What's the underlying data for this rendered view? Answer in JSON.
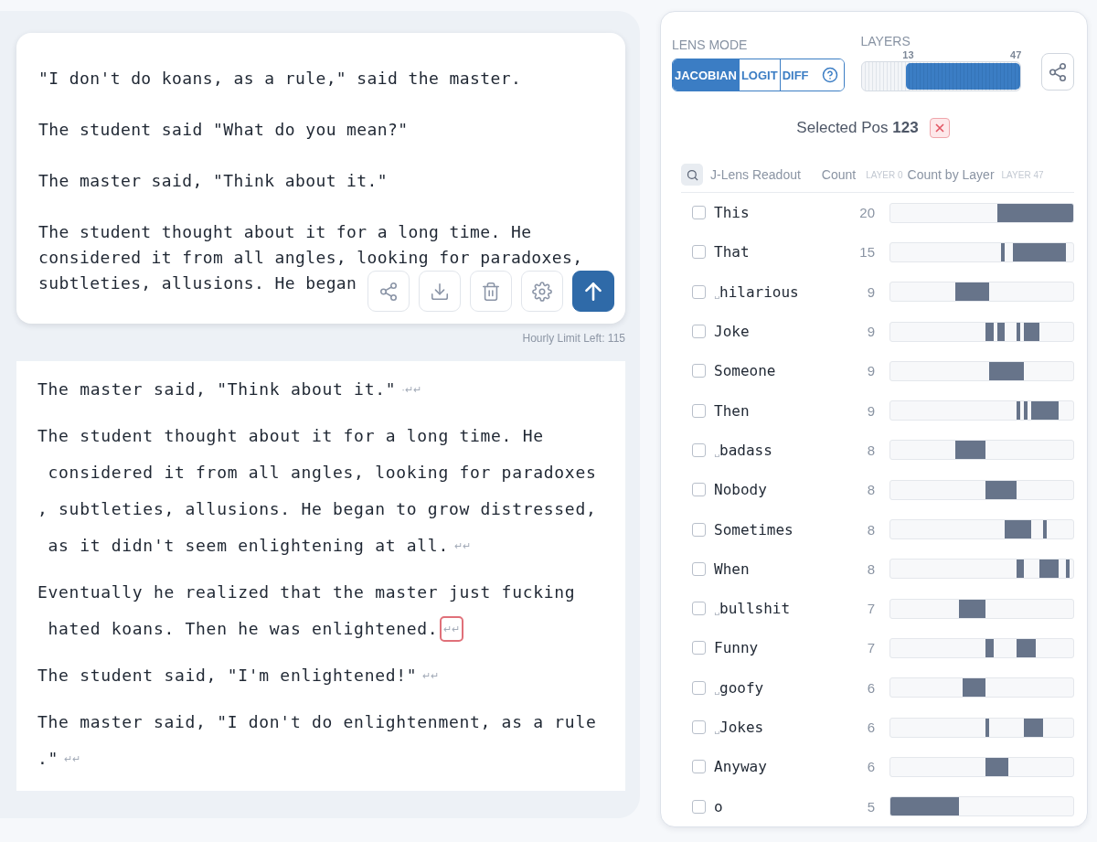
{
  "prompt": {
    "paragraphs": [
      {
        "lines": [
          "\"I don't do koans, as a rule,\" said the master."
        ]
      },
      {
        "lines": [
          "The student said \"What do you mean?\""
        ]
      },
      {
        "lines": [
          "The master said, \"Think about it.\""
        ]
      },
      {
        "lines": [
          "The student thought about it for a long time. He",
          "considered it from all angles, looking for paradoxes,",
          "subtleties, allusions. He began"
        ]
      }
    ],
    "toolbar": [
      {
        "kind": "share"
      },
      {
        "kind": "download"
      },
      {
        "kind": "delete"
      },
      {
        "kind": "settings"
      },
      {
        "kind": "send"
      }
    ]
  },
  "hourly_limit": "Hourly Limit Left: 115",
  "output": [
    {
      "lines": [
        "The master said, \"Think about it.\""
      ],
      "newline_mark": "·↵↵",
      "selected": false
    },
    {
      "lines": [
        "The student thought about it for a long time. He",
        " considered it from all angles, looking for paradoxes",
        ", subtleties, allusions. He began to grow distressed,",
        " as it didn't seem enlightening at all."
      ],
      "newline_mark": "↵↵",
      "selected": false
    },
    {
      "lines": [
        "Eventually he realized that the master just fucking",
        " hated koans. Then he was enlightened."
      ],
      "newline_mark": "↵↵",
      "selected": true
    },
    {
      "lines": [
        "The student said, \"I'm enlightened!\""
      ],
      "newline_mark": "↵↵",
      "selected": false
    },
    {
      "lines": [
        "The master said, \"I don't do enlightenment, as a rule",
        ".\""
      ],
      "newline_mark": "↵↵",
      "selected": false
    }
  ],
  "lens_mode": {
    "label": "LENS MODE",
    "tabs": [
      {
        "label": "JACOBIAN",
        "selected": true
      },
      {
        "label": "LOGIT",
        "selected": false
      },
      {
        "label": "DIFF",
        "selected": false,
        "help": true
      }
    ]
  },
  "layers": {
    "label": "LAYERS",
    "handles": [
      {
        "label": "13"
      },
      {
        "label": "47"
      }
    ]
  },
  "selected_pos": "Selected Pos **123**",
  "readout": {
    "columns": [
      "J-Lens Readout",
      "Count",
      "LAYER 0",
      "Count by Layer",
      "LAYER 47"
    ],
    "rows": [
      {
        "token": "This",
        "count": "20",
        "checked": false,
        "layers": [
          false,
          false,
          false,
          false,
          false,
          false,
          false,
          false,
          false,
          false,
          false,
          false,
          false,
          false,
          false,
          false,
          false,
          false,
          false,
          false,
          false,
          false,
          false,
          false,
          false,
          false,
          false,
          false,
          true,
          true,
          true,
          true,
          true,
          true,
          true,
          true,
          true,
          true,
          true,
          true,
          true,
          true,
          true,
          true,
          true,
          true,
          true,
          true
        ]
      },
      {
        "token": "That",
        "count": "15",
        "checked": false,
        "layers": [
          false,
          false,
          false,
          false,
          false,
          false,
          false,
          false,
          false,
          false,
          false,
          false,
          false,
          false,
          false,
          false,
          false,
          false,
          false,
          false,
          false,
          false,
          false,
          false,
          false,
          false,
          false,
          false,
          false,
          true,
          false,
          false,
          true,
          true,
          true,
          true,
          true,
          true,
          true,
          true,
          true,
          true,
          true,
          true,
          true,
          true,
          false,
          false
        ]
      },
      {
        "prefix": "␣",
        "token": "hilarious",
        "count": "9",
        "checked": false,
        "layers": [
          false,
          false,
          false,
          false,
          false,
          false,
          false,
          false,
          false,
          false,
          false,
          false,
          false,
          false,
          false,
          false,
          false,
          true,
          true,
          true,
          true,
          true,
          true,
          true,
          true,
          true,
          false,
          false,
          false,
          false,
          false,
          false,
          false,
          false,
          false,
          false,
          false,
          false,
          false,
          false,
          false,
          false,
          false,
          false,
          false,
          false,
          false,
          false
        ]
      },
      {
        "token": "Joke",
        "count": "9",
        "checked": false,
        "layers": [
          false,
          false,
          false,
          false,
          false,
          false,
          false,
          false,
          false,
          false,
          false,
          false,
          false,
          false,
          false,
          false,
          false,
          false,
          false,
          false,
          false,
          false,
          false,
          false,
          false,
          true,
          true,
          false,
          true,
          true,
          false,
          false,
          false,
          true,
          false,
          true,
          true,
          true,
          true,
          false,
          false,
          false,
          false,
          false,
          false,
          false,
          false,
          false
        ]
      },
      {
        "token": "Someone",
        "count": "9",
        "checked": false,
        "layers": [
          false,
          false,
          false,
          false,
          false,
          false,
          false,
          false,
          false,
          false,
          false,
          false,
          false,
          false,
          false,
          false,
          false,
          false,
          false,
          false,
          false,
          false,
          false,
          false,
          false,
          false,
          true,
          true,
          true,
          true,
          true,
          true,
          true,
          true,
          true,
          false,
          false,
          false,
          false,
          false,
          false,
          false,
          false,
          false,
          false,
          false,
          false,
          false
        ]
      },
      {
        "token": "Then",
        "count": "9",
        "checked": false,
        "layers": [
          false,
          false,
          false,
          false,
          false,
          false,
          false,
          false,
          false,
          false,
          false,
          false,
          false,
          false,
          false,
          false,
          false,
          false,
          false,
          false,
          false,
          false,
          false,
          false,
          false,
          false,
          false,
          false,
          false,
          false,
          false,
          false,
          false,
          true,
          false,
          true,
          false,
          true,
          true,
          true,
          true,
          true,
          true,
          true,
          false,
          false,
          false,
          false
        ]
      },
      {
        "prefix": "␣",
        "token": "badass",
        "count": "8",
        "checked": false,
        "layers": [
          false,
          false,
          false,
          false,
          false,
          false,
          false,
          false,
          false,
          false,
          false,
          false,
          false,
          false,
          false,
          false,
          false,
          true,
          true,
          true,
          true,
          true,
          true,
          true,
          true,
          false,
          false,
          false,
          false,
          false,
          false,
          false,
          false,
          false,
          false,
          false,
          false,
          false,
          false,
          false,
          false,
          false,
          false,
          false,
          false,
          false,
          false,
          false
        ]
      },
      {
        "token": "Nobody",
        "count": "8",
        "checked": false,
        "layers": [
          false,
          false,
          false,
          false,
          false,
          false,
          false,
          false,
          false,
          false,
          false,
          false,
          false,
          false,
          false,
          false,
          false,
          false,
          false,
          false,
          false,
          false,
          false,
          false,
          false,
          true,
          true,
          true,
          true,
          true,
          true,
          true,
          true,
          false,
          false,
          false,
          false,
          false,
          false,
          false,
          false,
          false,
          false,
          false,
          false,
          false,
          false,
          false
        ]
      },
      {
        "token": "Sometimes",
        "count": "8",
        "checked": false,
        "layers": [
          false,
          false,
          false,
          false,
          false,
          false,
          false,
          false,
          false,
          false,
          false,
          false,
          false,
          false,
          false,
          false,
          false,
          false,
          false,
          false,
          false,
          false,
          false,
          false,
          false,
          false,
          false,
          false,
          false,
          false,
          true,
          true,
          true,
          true,
          true,
          true,
          true,
          false,
          false,
          false,
          true,
          false,
          false,
          false,
          false,
          false,
          false,
          false
        ]
      },
      {
        "token": "When",
        "count": "8",
        "checked": false,
        "layers": [
          false,
          false,
          false,
          false,
          false,
          false,
          false,
          false,
          false,
          false,
          false,
          false,
          false,
          false,
          false,
          false,
          false,
          false,
          false,
          false,
          false,
          false,
          false,
          false,
          false,
          false,
          false,
          false,
          false,
          false,
          false,
          false,
          false,
          true,
          true,
          false,
          false,
          false,
          false,
          true,
          true,
          true,
          true,
          true,
          false,
          false,
          true,
          false
        ]
      },
      {
        "prefix": "␣",
        "token": "bullshit",
        "count": "7",
        "checked": false,
        "layers": [
          false,
          false,
          false,
          false,
          false,
          false,
          false,
          false,
          false,
          false,
          false,
          false,
          false,
          false,
          false,
          false,
          false,
          false,
          true,
          true,
          true,
          true,
          true,
          true,
          true,
          false,
          false,
          false,
          false,
          false,
          false,
          false,
          false,
          false,
          false,
          false,
          false,
          false,
          false,
          false,
          false,
          false,
          false,
          false,
          false,
          false,
          false,
          false
        ]
      },
      {
        "token": "Funny",
        "count": "7",
        "checked": false,
        "layers": [
          false,
          false,
          false,
          false,
          false,
          false,
          false,
          false,
          false,
          false,
          false,
          false,
          false,
          false,
          false,
          false,
          false,
          false,
          false,
          false,
          false,
          false,
          false,
          false,
          false,
          true,
          true,
          false,
          false,
          false,
          false,
          false,
          false,
          true,
          true,
          true,
          true,
          true,
          false,
          false,
          false,
          false,
          false,
          false,
          false,
          false,
          false,
          false
        ]
      },
      {
        "prefix": "␣",
        "token": "goofy",
        "count": "6",
        "checked": false,
        "layers": [
          false,
          false,
          false,
          false,
          false,
          false,
          false,
          false,
          false,
          false,
          false,
          false,
          false,
          false,
          false,
          false,
          false,
          false,
          false,
          true,
          true,
          true,
          true,
          true,
          true,
          false,
          false,
          false,
          false,
          false,
          false,
          false,
          false,
          false,
          false,
          false,
          false,
          false,
          false,
          false,
          false,
          false,
          false,
          false,
          false,
          false,
          false,
          false
        ]
      },
      {
        "prefix": "␣",
        "token": "Jokes",
        "count": "6",
        "checked": false,
        "layers": [
          false,
          false,
          false,
          false,
          false,
          false,
          false,
          false,
          false,
          false,
          false,
          false,
          false,
          false,
          false,
          false,
          false,
          false,
          false,
          false,
          false,
          false,
          false,
          false,
          false,
          true,
          false,
          false,
          false,
          false,
          false,
          false,
          false,
          false,
          false,
          true,
          true,
          true,
          true,
          true,
          false,
          false,
          false,
          false,
          false,
          false,
          false,
          false
        ]
      },
      {
        "token": "Anyway",
        "count": "6",
        "checked": false,
        "layers": [
          false,
          false,
          false,
          false,
          false,
          false,
          false,
          false,
          false,
          false,
          false,
          false,
          false,
          false,
          false,
          false,
          false,
          false,
          false,
          false,
          false,
          false,
          false,
          false,
          false,
          true,
          true,
          true,
          true,
          true,
          true,
          false,
          false,
          false,
          false,
          false,
          false,
          false,
          false,
          false,
          false,
          false,
          false,
          false,
          false,
          false,
          false,
          false
        ]
      },
      {
        "token": "o",
        "count": "5",
        "checked": false,
        "layers": [
          true,
          true,
          true,
          true,
          true,
          true,
          true,
          true,
          true,
          true,
          true,
          true,
          true,
          true,
          true,
          true,
          true,
          true,
          false,
          false,
          false,
          false,
          false,
          false,
          false,
          false,
          false,
          false,
          false,
          false,
          false,
          false,
          false,
          false,
          false,
          false,
          false,
          false,
          false,
          false,
          false,
          false,
          false,
          false,
          false,
          false,
          false,
          false
        ]
      }
    ]
  }
}
